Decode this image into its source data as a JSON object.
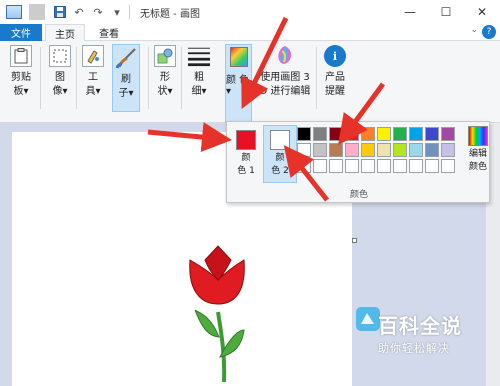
{
  "titlebar": {
    "title": "无标题 - 画图",
    "minimize_icon": "minimize-icon",
    "maximize_icon": "maximize-icon",
    "close_icon": "close-icon"
  },
  "tabs": {
    "file": "文件",
    "home": "主页",
    "view": "查看",
    "help": "?"
  },
  "ribbon": {
    "clipboard": "剪贴\n板▾",
    "image": "图\n像▾",
    "tools": "工\n具▾",
    "brushes": "刷\n子▾",
    "shapes": "形\n状▾",
    "size": "粗\n细▾",
    "colors": "颜\n色▾",
    "paint3d": "使用画图 3\nD 进行编辑",
    "feedback": "产品\n提醒"
  },
  "colors_panel": {
    "color1_label": "颜\n色 1",
    "color2_label": "颜\n色 2",
    "edit_colors_label": "编辑\n颜色",
    "group_caption": "颜色",
    "color1": "#e81123",
    "color2": "#ffffff",
    "palette": [
      "#000000",
      "#7f7f7f",
      "#880015",
      "#ed1c24",
      "#ff7f27",
      "#fff200",
      "#22b14c",
      "#00a2e8",
      "#3f48cc",
      "#a349a4",
      "#ffffff",
      "#c3c3c3",
      "#b97a57",
      "#ffaec9",
      "#ffc90e",
      "#efe4b0",
      "#b5e61d",
      "#99d9ea",
      "#7092be",
      "#c8bfe7",
      "#ffffff",
      "#ffffff",
      "#ffffff",
      "#ffffff",
      "#ffffff",
      "#ffffff",
      "#ffffff",
      "#ffffff",
      "#ffffff",
      "#ffffff"
    ]
  },
  "watermark": {
    "title": "百科全说",
    "subtitle": "助你轻松解决"
  },
  "accent": "#1979ca",
  "arrow_color": "#e5332a"
}
